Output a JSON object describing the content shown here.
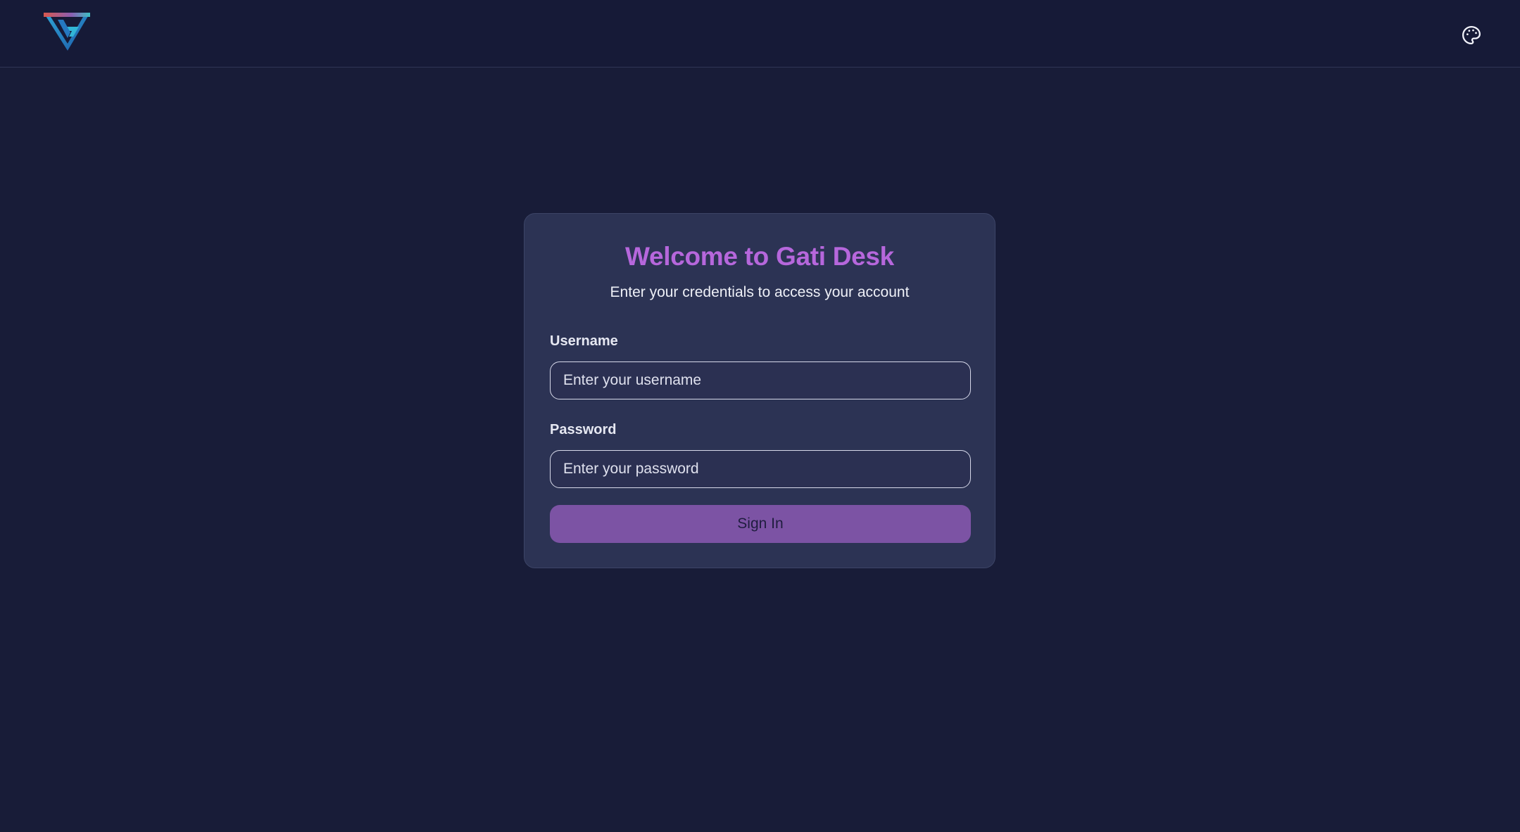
{
  "header": {
    "logo_icon": "gati-logo-icon",
    "theme_icon": "palette-icon"
  },
  "login": {
    "title": "Welcome to Gati Desk",
    "subtitle": "Enter your credentials to access your account",
    "username_label": "Username",
    "username_placeholder": "Enter your username",
    "username_value": "",
    "password_label": "Password",
    "password_placeholder": "Enter your password",
    "password_value": "",
    "submit_label": "Sign In"
  },
  "colors": {
    "background": "#181c38",
    "card": "#2c3354",
    "title": "#b667dc",
    "button": "#7c53a4"
  }
}
